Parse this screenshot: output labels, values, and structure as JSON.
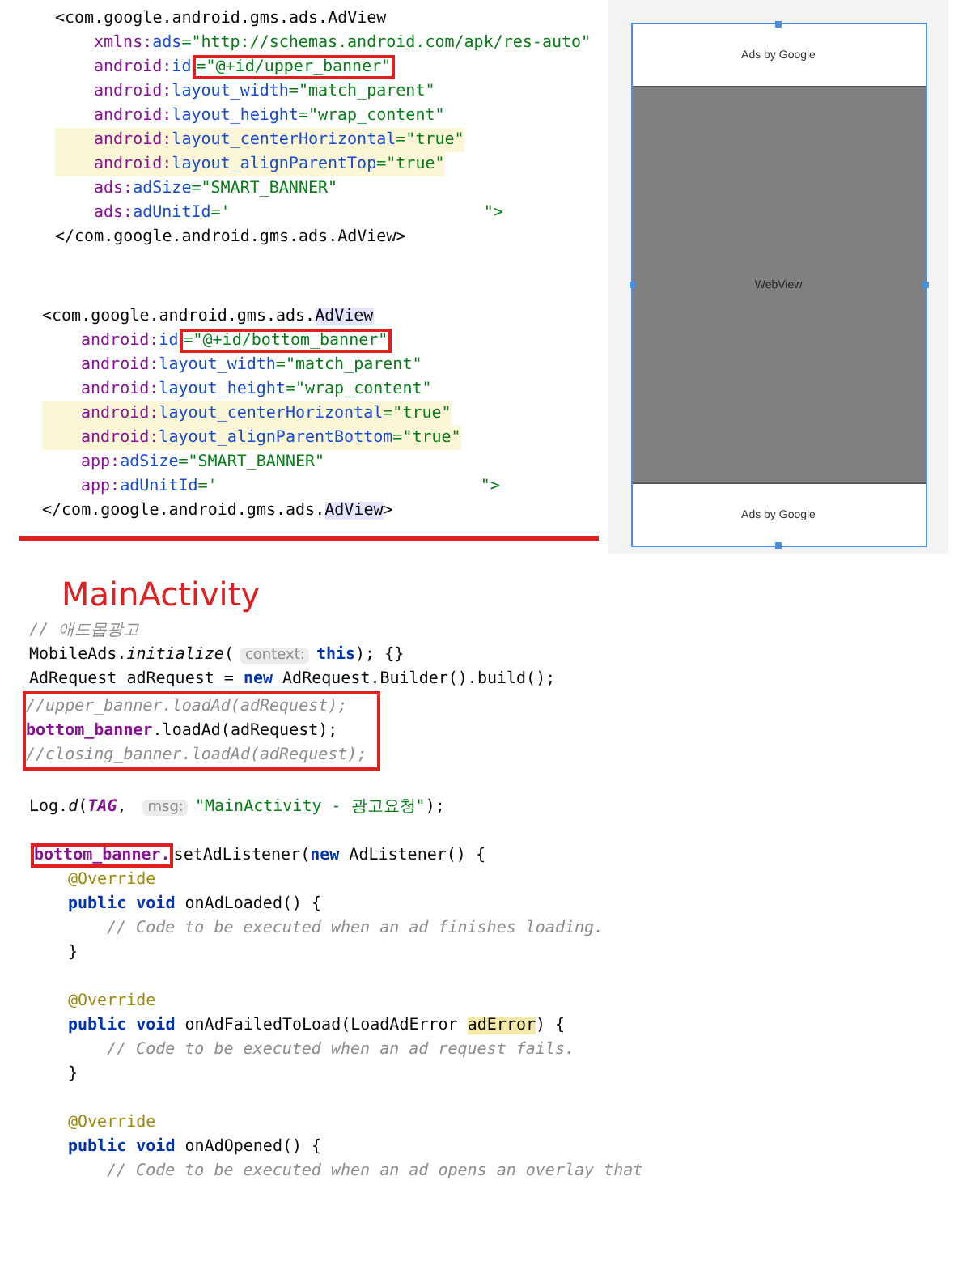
{
  "xml_blocks": [
    {
      "lines": [
        {
          "kind": "tag",
          "highlighted": false,
          "tokens": [
            {
              "kind": "plain",
              "text": "<com.google.android.gms.ads.AdView"
            }
          ]
        },
        {
          "kind": "attribute",
          "highlighted": false,
          "tokens": [
            {
              "kind": "ns",
              "text": "xmlns:"
            },
            {
              "kind": "attr",
              "text": "ads"
            },
            {
              "kind": "str",
              "text": "=\"http://schemas.android.com/apk/res-auto\""
            }
          ]
        },
        {
          "kind": "attribute",
          "highlighted": false,
          "tokens": [
            {
              "kind": "ns",
              "text": "android:"
            },
            {
              "kind": "attr",
              "text": "id"
            },
            {
              "kind": "str",
              "text": "=\"@+id/upper_banner\"",
              "boxed": true
            }
          ]
        },
        {
          "kind": "attribute",
          "highlighted": false,
          "tokens": [
            {
              "kind": "ns",
              "text": "android:"
            },
            {
              "kind": "attr",
              "text": "layout_width"
            },
            {
              "kind": "str",
              "text": "=\"match_parent\""
            }
          ]
        },
        {
          "kind": "attribute",
          "highlighted": false,
          "tokens": [
            {
              "kind": "ns",
              "text": "android:"
            },
            {
              "kind": "attr",
              "text": "layout_height"
            },
            {
              "kind": "str",
              "text": "=\"wrap_content\""
            }
          ]
        },
        {
          "kind": "attribute",
          "highlighted": true,
          "tokens": [
            {
              "kind": "ns",
              "text": "android:"
            },
            {
              "kind": "attr",
              "text": "layout_centerHorizontal"
            },
            {
              "kind": "str",
              "text": "=\"true\""
            }
          ]
        },
        {
          "kind": "attribute",
          "highlighted": true,
          "tokens": [
            {
              "kind": "ns",
              "text": "android:"
            },
            {
              "kind": "attr",
              "text": "layout_alignParentTop"
            },
            {
              "kind": "str",
              "text": "=\"true\""
            }
          ]
        },
        {
          "kind": "attribute",
          "highlighted": false,
          "tokens": [
            {
              "kind": "ns",
              "text": "ads:"
            },
            {
              "kind": "attr",
              "text": "adSize"
            },
            {
              "kind": "str",
              "text": "=\"SMART_BANNER\""
            }
          ]
        },
        {
          "kind": "attribute",
          "highlighted": false,
          "tokens": [
            {
              "kind": "ns",
              "text": "ads:"
            },
            {
              "kind": "attr",
              "text": "adUnitId"
            },
            {
              "kind": "str",
              "text": "='                          \">"
            }
          ]
        },
        {
          "kind": "tag",
          "highlighted": false,
          "tokens": [
            {
              "kind": "plain",
              "text": "</com.google.android.gms.ads.AdView>"
            }
          ]
        }
      ]
    },
    {
      "lines": [
        {
          "kind": "tag",
          "highlighted": false,
          "tokens": [
            {
              "kind": "plain",
              "text": "<com.google.android.gms.ads."
            },
            {
              "kind": "match",
              "text": "AdView"
            }
          ]
        },
        {
          "kind": "attribute",
          "highlighted": false,
          "tokens": [
            {
              "kind": "ns",
              "text": "android:"
            },
            {
              "kind": "attr",
              "text": "id"
            },
            {
              "kind": "str",
              "text": "=\"@+id/bottom_banner\"",
              "boxed": true
            }
          ]
        },
        {
          "kind": "attribute",
          "highlighted": false,
          "tokens": [
            {
              "kind": "ns",
              "text": "android:"
            },
            {
              "kind": "attr",
              "text": "layout_width"
            },
            {
              "kind": "str",
              "text": "=\"match_parent\""
            }
          ]
        },
        {
          "kind": "attribute",
          "highlighted": false,
          "tokens": [
            {
              "kind": "ns",
              "text": "android:"
            },
            {
              "kind": "attr",
              "text": "layout_height"
            },
            {
              "kind": "str",
              "text": "=\"wrap_content\""
            }
          ]
        },
        {
          "kind": "attribute",
          "highlighted": true,
          "tokens": [
            {
              "kind": "ns",
              "text": "android:"
            },
            {
              "kind": "attr",
              "text": "layout_centerHorizontal"
            },
            {
              "kind": "str",
              "text": "=\"true\""
            }
          ]
        },
        {
          "kind": "attribute",
          "highlighted": true,
          "tokens": [
            {
              "kind": "ns",
              "text": "android:"
            },
            {
              "kind": "attr",
              "text": "layout_alignParentBottom"
            },
            {
              "kind": "str",
              "text": "=\"true\""
            }
          ]
        },
        {
          "kind": "attribute",
          "highlighted": false,
          "tokens": [
            {
              "kind": "ns",
              "text": "app:"
            },
            {
              "kind": "attr",
              "text": "adSize"
            },
            {
              "kind": "str",
              "text": "=\"SMART_BANNER\""
            }
          ]
        },
        {
          "kind": "attribute",
          "highlighted": false,
          "tokens": [
            {
              "kind": "ns",
              "text": "app:"
            },
            {
              "kind": "attr",
              "text": "adUnitId"
            },
            {
              "kind": "str",
              "text": "='                           \">"
            }
          ]
        },
        {
          "kind": "tag",
          "highlighted": false,
          "tokens": [
            {
              "kind": "plain",
              "text": "</com.google.android.gms.ads."
            },
            {
              "kind": "match",
              "text": "AdView"
            },
            {
              "kind": "plain",
              "text": ">"
            }
          ]
        }
      ]
    }
  ],
  "preview": {
    "top_banner": "Ads by Google",
    "content": "WebView",
    "bottom_banner": "Ads by Google"
  },
  "section_title": "MainActivity",
  "java_lines": [
    {
      "kind": "statement",
      "boxed": false,
      "tokens": [
        {
          "kind": "comment",
          "text": "// 애드몹광고"
        }
      ]
    },
    {
      "kind": "statement",
      "boxed": false,
      "tokens": [
        {
          "kind": "plain",
          "text": "MobileAds."
        },
        {
          "kind": "italic",
          "text": "initialize"
        },
        {
          "kind": "plain",
          "text": "("
        },
        {
          "kind": "hint",
          "text": "context:"
        },
        {
          "kind": "kw",
          "text": "this"
        },
        {
          "kind": "plain",
          "text": "); {}"
        }
      ]
    },
    {
      "kind": "statement",
      "boxed": false,
      "tokens": [
        {
          "kind": "plain",
          "text": "AdRequest adRequest = "
        },
        {
          "kind": "kw",
          "text": "new"
        },
        {
          "kind": "plain",
          "text": " AdRequest.Builder().build();"
        }
      ]
    },
    {
      "kind": "statement",
      "boxed": true,
      "tokens": [
        {
          "kind": "comment",
          "text": "//upper_banner.loadAd(adRequest);"
        }
      ]
    },
    {
      "kind": "statement",
      "boxed": true,
      "tokens": [
        {
          "kind": "field",
          "text": "bottom_banner"
        },
        {
          "kind": "plain",
          "text": ".loadAd(adRequest);"
        }
      ]
    },
    {
      "kind": "statement",
      "boxed": true,
      "tokens": [
        {
          "kind": "comment",
          "text": "//closing_banner.loadAd(adRequest);"
        }
      ]
    },
    {
      "kind": "blank"
    },
    {
      "kind": "statement",
      "boxed": false,
      "tokens": [
        {
          "kind": "plain",
          "text": "Log."
        },
        {
          "kind": "italic",
          "text": "d"
        },
        {
          "kind": "plain",
          "text": "("
        },
        {
          "kind": "const",
          "text": "TAG"
        },
        {
          "kind": "plain",
          "text": ", "
        },
        {
          "kind": "hint",
          "text": "msg:"
        },
        {
          "kind": "str",
          "text": "\"MainActivity - 광고요청\""
        },
        {
          "kind": "plain",
          "text": ");"
        }
      ]
    },
    {
      "kind": "blank"
    },
    {
      "kind": "statement",
      "boxed": false,
      "tokens": [
        {
          "kind": "field",
          "text": "bottom_banner.",
          "boxed": true
        },
        {
          "kind": "plain",
          "text": "setAdListener("
        },
        {
          "kind": "kw",
          "text": "new"
        },
        {
          "kind": "plain",
          "text": " AdListener() {"
        }
      ]
    },
    {
      "kind": "member",
      "boxed": false,
      "tokens": [
        {
          "kind": "annot",
          "text": "@Override"
        }
      ]
    },
    {
      "kind": "member",
      "boxed": false,
      "tokens": [
        {
          "kind": "kw",
          "text": "public void"
        },
        {
          "kind": "plain",
          "text": " onAdLoaded() {"
        }
      ]
    },
    {
      "kind": "body",
      "boxed": false,
      "tokens": [
        {
          "kind": "comment",
          "text": "// Code to be executed when an ad finishes loading."
        }
      ]
    },
    {
      "kind": "member",
      "boxed": false,
      "tokens": [
        {
          "kind": "plain",
          "text": "}"
        }
      ]
    },
    {
      "kind": "blank"
    },
    {
      "kind": "member",
      "boxed": false,
      "tokens": [
        {
          "kind": "annot",
          "text": "@Override"
        }
      ]
    },
    {
      "kind": "member",
      "boxed": false,
      "tokens": [
        {
          "kind": "kw",
          "text": "public void"
        },
        {
          "kind": "plain",
          "text": " onAdFailedToLoad(LoadAdError "
        },
        {
          "kind": "usage",
          "text": "adError"
        },
        {
          "kind": "plain",
          "text": ") {"
        }
      ]
    },
    {
      "kind": "body",
      "boxed": false,
      "tokens": [
        {
          "kind": "comment",
          "text": "// Code to be executed when an ad request fails."
        }
      ]
    },
    {
      "kind": "member",
      "boxed": false,
      "tokens": [
        {
          "kind": "plain",
          "text": "}"
        }
      ]
    },
    {
      "kind": "blank"
    },
    {
      "kind": "member",
      "boxed": false,
      "tokens": [
        {
          "kind": "annot",
          "text": "@Override"
        }
      ]
    },
    {
      "kind": "member",
      "boxed": false,
      "tokens": [
        {
          "kind": "kw",
          "text": "public void"
        },
        {
          "kind": "plain",
          "text": " onAdOpened() {"
        }
      ]
    },
    {
      "kind": "body",
      "boxed": false,
      "tokens": [
        {
          "kind": "comment",
          "text": "// Code to be executed when an ad opens an overlay that"
        }
      ]
    }
  ]
}
